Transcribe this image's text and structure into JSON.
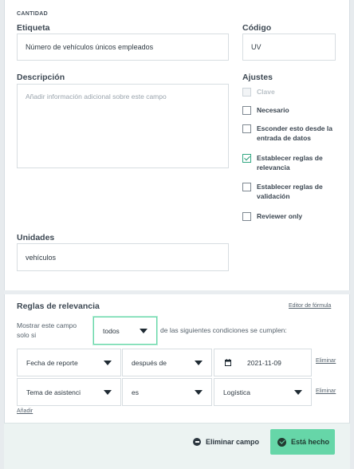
{
  "question": {
    "type_label": "CANTIDAD",
    "label_field": {
      "label": "Etiqueta",
      "value": "Número de vehículos únicos empleados"
    },
    "code_field": {
      "label": "Código",
      "value": "UV"
    },
    "description_field": {
      "label": "Descripción",
      "placeholder": "Añadir información adicional sobre este campo"
    },
    "units_field": {
      "label": "Unidades",
      "value": "vehículos"
    }
  },
  "settings": {
    "title": "Ajustes",
    "options": [
      {
        "label": "Clave",
        "checked": false,
        "disabled": true
      },
      {
        "label": "Necesario",
        "checked": false,
        "disabled": false
      },
      {
        "label": "Esconder esto desde la entrada de datos",
        "checked": false,
        "disabled": false
      },
      {
        "label": "Establecer reglas de relevancia",
        "checked": true,
        "disabled": false
      },
      {
        "label": "Establecer reglas de validación",
        "checked": false,
        "disabled": false
      },
      {
        "label": "Reviewer only",
        "checked": false,
        "disabled": false
      }
    ]
  },
  "relevance": {
    "title": "Reglas de relevancia",
    "formula_link": "Editor de fórmula",
    "show_prefix": "Mostrar este campo solo si",
    "condition_mode": "todos",
    "show_suffix": "de las siguientes condiciones se cumplen:",
    "rules": [
      {
        "field": "Fecha de reporte",
        "operator": "después de",
        "value": "2021-11-09",
        "value_kind": "date",
        "remove_label": "Eliminar"
      },
      {
        "field": "Tema de asistenci",
        "operator": "es",
        "value": "Logística",
        "value_kind": "select",
        "remove_label": "Eliminar"
      }
    ],
    "add_label": "Añadir"
  },
  "footer": {
    "delete_label": "Eliminar campo",
    "done_label": "Está hecho"
  },
  "colors": {
    "accent": "#66d6a8",
    "checkbox_check": "#2c9c78",
    "footer_bg": "#ecf3f2"
  }
}
